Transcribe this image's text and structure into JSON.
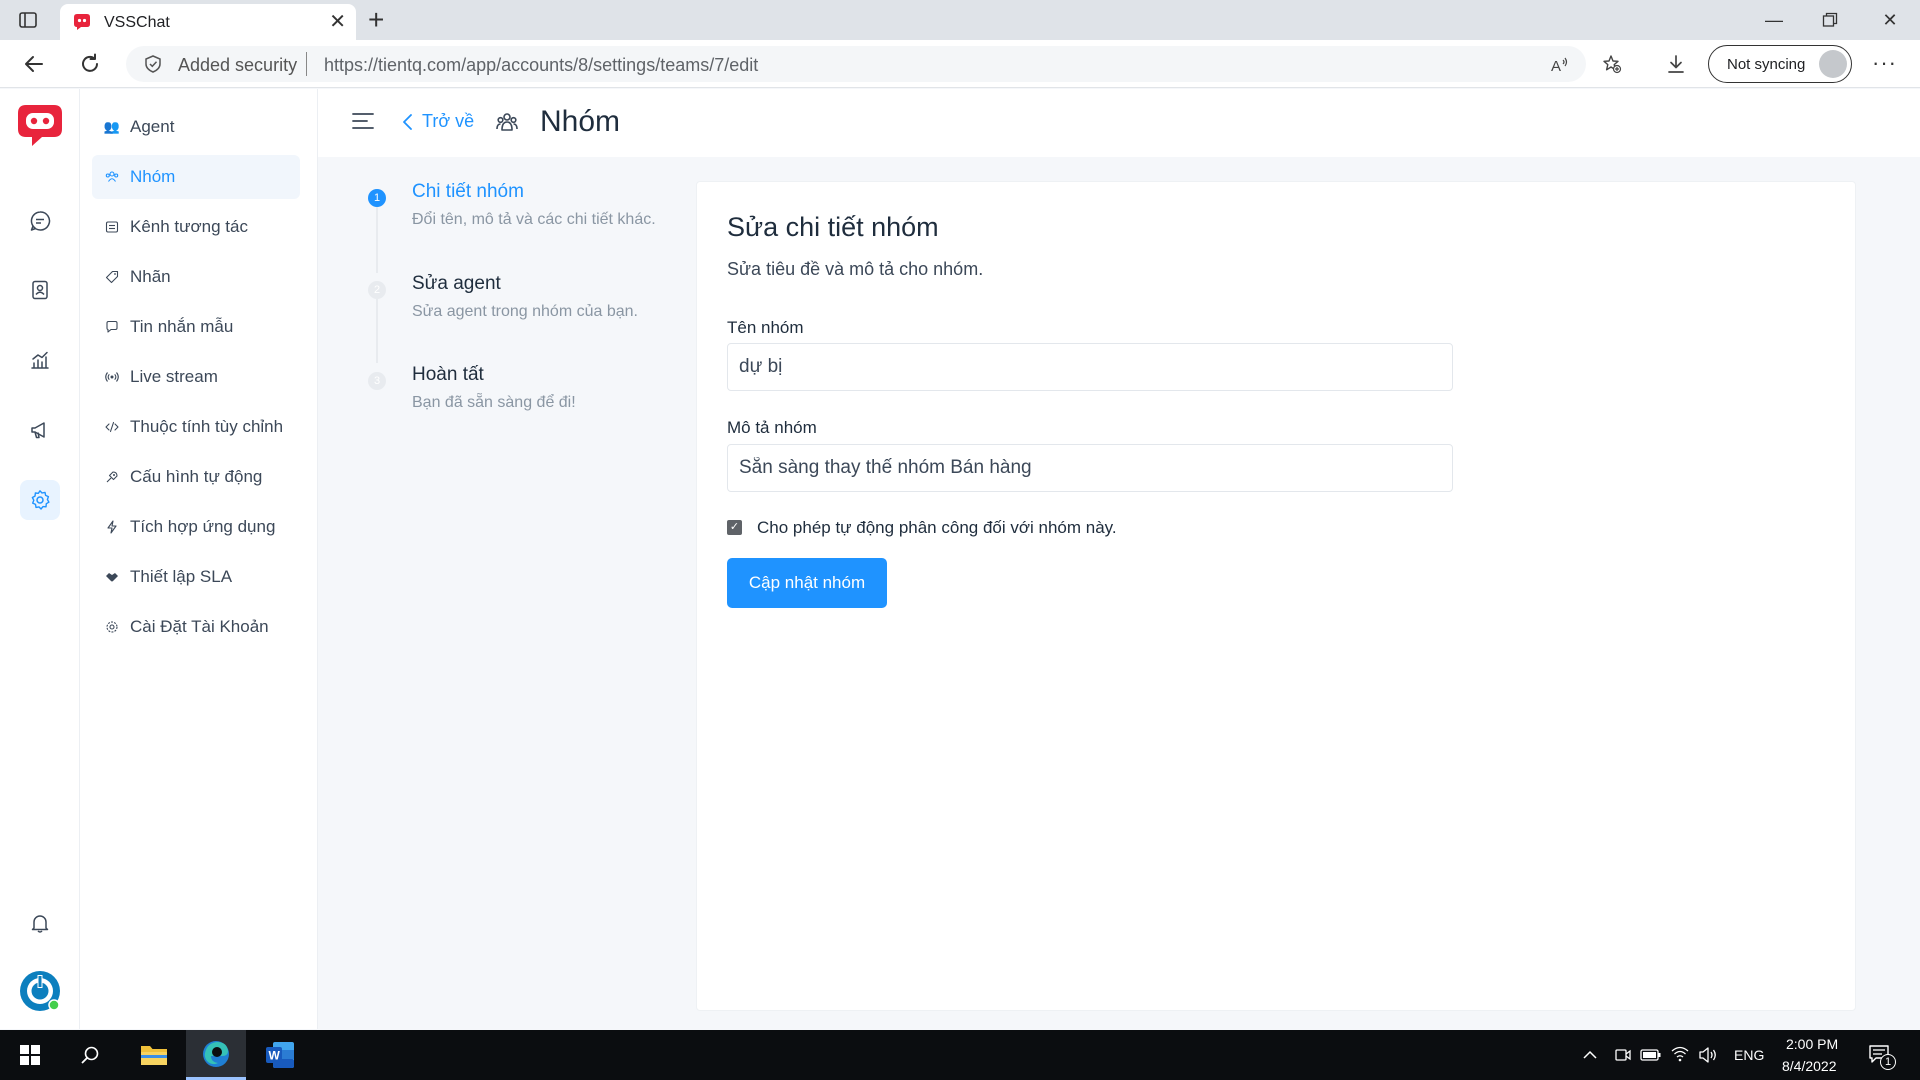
{
  "browser": {
    "tab_title": "VSSChat",
    "security_label": "Added security",
    "url": "https://tientq.com/app/accounts/8/settings/teams/7/edit",
    "sync_label": "Not syncing"
  },
  "sidebar": {
    "items": [
      {
        "label": "Agent",
        "icon": "agents-icon"
      },
      {
        "label": "Nhóm",
        "icon": "team-icon"
      },
      {
        "label": "Kênh tương tác",
        "icon": "inbox-icon"
      },
      {
        "label": "Nhãn",
        "icon": "tag-icon"
      },
      {
        "label": "Tin nhắn mẫu",
        "icon": "canned-message-icon"
      },
      {
        "label": "Live stream",
        "icon": "livestream-icon"
      },
      {
        "label": "Thuộc tính tùy chỉnh",
        "icon": "code-icon"
      },
      {
        "label": "Cấu hình tự động",
        "icon": "automation-icon"
      },
      {
        "label": "Tích hợp ứng dụng",
        "icon": "flash-icon"
      },
      {
        "label": "Thiết lập SLA",
        "icon": "handshake-icon"
      },
      {
        "label": "Cài Đặt Tài Khoản",
        "icon": "settings-icon"
      }
    ]
  },
  "header": {
    "back_label": "Trở về",
    "title": "Nhóm"
  },
  "wizard": {
    "steps": [
      {
        "number": "1",
        "title": "Chi tiết nhóm",
        "description": "Đổi tên, mô tả và các chi tiết khác."
      },
      {
        "number": "2",
        "title": "Sửa agent",
        "description": "Sửa agent trong nhóm của bạn."
      },
      {
        "number": "3",
        "title": "Hoàn tất",
        "description": "Bạn đã sẵn sàng để đi!"
      }
    ]
  },
  "form": {
    "title": "Sửa chi tiết nhóm",
    "subtitle": "Sửa tiêu đề và mô tả cho nhóm.",
    "name_label": "Tên nhóm",
    "name_value": "dự bị",
    "desc_label": "Mô tả nhóm",
    "desc_value": "Sẵn sàng thay thế nhóm Bán hàng",
    "checkbox_label": "Cho phép tự động phân công đối với nhóm này.",
    "checkbox_checked": true,
    "submit_label": "Cập nhật nhóm"
  },
  "taskbar": {
    "language": "ENG",
    "time": "2:00 PM",
    "date": "8/4/2022",
    "notification_count": "1"
  },
  "colors": {
    "accent": "#1f93ff",
    "brand_red": "#e8243c"
  }
}
